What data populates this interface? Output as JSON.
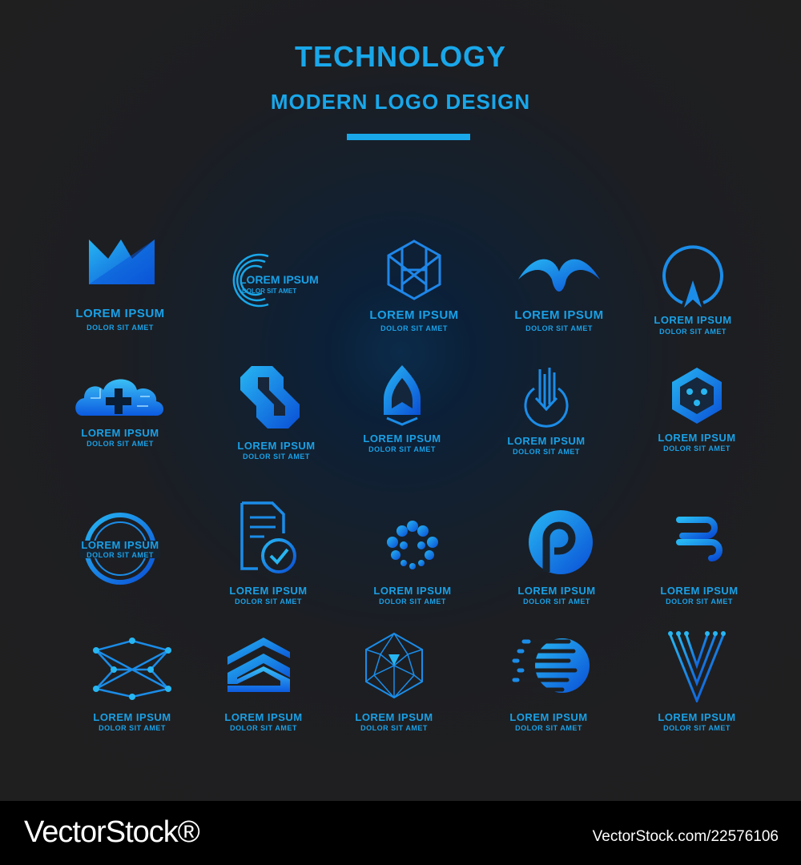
{
  "header": {
    "title": "TECHNOLOGY",
    "subtitle": "MODERN LOGO DESIGN"
  },
  "colors": {
    "accent": "#19a7ea",
    "background": "#1f1f21",
    "deep": "#0a4fd6"
  },
  "logos": [
    {
      "icon": "crown-icon",
      "name": "LOREM IPSUM",
      "sub": "DOLOR SIT AMET"
    },
    {
      "icon": "concentric-arc-icon",
      "name": "LOREM IPSUM",
      "sub": "DOLOR SIT AMET"
    },
    {
      "icon": "letter-h-hexagon-icon",
      "name": "LOREM IPSUM",
      "sub": "DOLOR SIT AMET"
    },
    {
      "icon": "wings-icon",
      "name": "LOREM IPSUM",
      "sub": "DOLOR SIT AMET"
    },
    {
      "icon": "circle-arrow-icon",
      "name": "LOREM IPSUM",
      "sub": "DOLOR SIT AMET"
    },
    {
      "icon": "cloud-plus-icon",
      "name": "LOREM IPSUM",
      "sub": "DOLOR SIT AMET"
    },
    {
      "icon": "infinity-link-icon",
      "name": "LOREM IPSUM",
      "sub": "DOLOR SIT AMET"
    },
    {
      "icon": "drop-gem-icon",
      "name": "LOREM IPSUM",
      "sub": "DOLOR SIT AMET"
    },
    {
      "icon": "circle-bars-icon",
      "name": "LOREM IPSUM",
      "sub": "DOLOR SIT AMET"
    },
    {
      "icon": "hexagon-dice-icon",
      "name": "LOREM IPSUM",
      "sub": "DOLOR SIT AMET"
    },
    {
      "icon": "ring-badge-icon",
      "name": "LOREM IPSUM",
      "sub": "DOLOR SIT AMET"
    },
    {
      "icon": "document-check-icon",
      "name": "LOREM IPSUM",
      "sub": "DOLOR SIT AMET"
    },
    {
      "icon": "dotted-sphere-icon",
      "name": "LOREM IPSUM",
      "sub": "DOLOR SIT AMET"
    },
    {
      "icon": "letter-p-circle-icon",
      "name": "LOREM IPSUM",
      "sub": "DOLOR SIT AMET"
    },
    {
      "icon": "letter-d-stripes-icon",
      "name": "LOREM IPSUM",
      "sub": "DOLOR SIT AMET"
    },
    {
      "icon": "network-nodes-icon",
      "name": "LOREM IPSUM",
      "sub": "DOLOR SIT AMET"
    },
    {
      "icon": "chevron-stack-icon",
      "name": "LOREM IPSUM",
      "sub": "DOLOR SIT AMET"
    },
    {
      "icon": "hexagon-mesh-icon",
      "name": "LOREM IPSUM",
      "sub": "DOLOR SIT AMET"
    },
    {
      "icon": "speed-circle-icon",
      "name": "LOREM IPSUM",
      "sub": "DOLOR SIT AMET"
    },
    {
      "icon": "letter-v-circuit-icon",
      "name": "LOREM IPSUM",
      "sub": "DOLOR SIT AMET"
    }
  ],
  "footer": {
    "brand": "VectorStock®",
    "image_id": "VectorStock.com/22576106"
  }
}
